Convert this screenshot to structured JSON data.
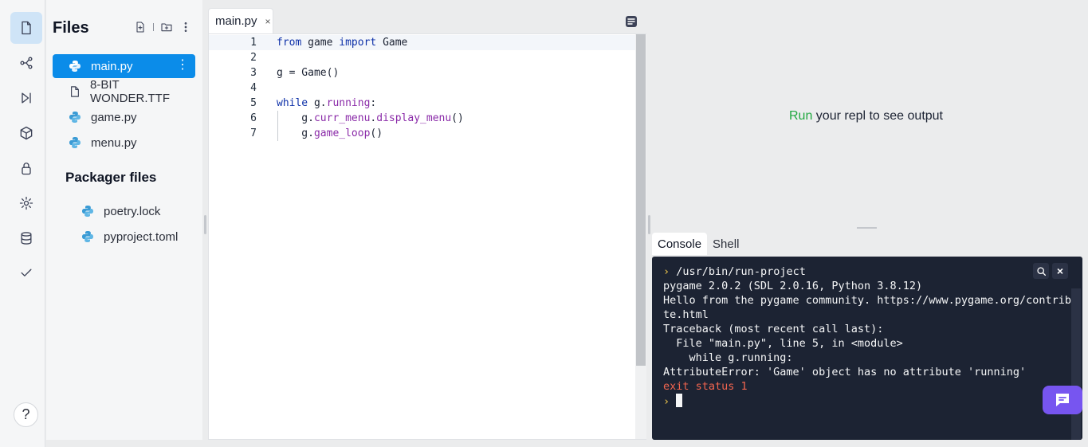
{
  "sidebar": {
    "title": "Files",
    "files": [
      {
        "name": "main.py",
        "icon": "python-icon",
        "active": true
      },
      {
        "name": "8-BIT WONDER.TTF",
        "icon": "file-icon",
        "active": false
      },
      {
        "name": "game.py",
        "icon": "python-icon",
        "active": false
      },
      {
        "name": "menu.py",
        "icon": "python-icon",
        "active": false
      }
    ],
    "packager_title": "Packager files",
    "packager_files": [
      {
        "name": "poetry.lock",
        "icon": "python-icon"
      },
      {
        "name": "pyproject.toml",
        "icon": "python-icon"
      }
    ],
    "more_glyph": "⋮",
    "help_glyph": "?"
  },
  "editor": {
    "tab_label": "main.py",
    "tab_close": "×",
    "lines": [
      {
        "n": "1",
        "text": "from game import Game"
      },
      {
        "n": "2",
        "text": ""
      },
      {
        "n": "3",
        "text": "g = Game()"
      },
      {
        "n": "4",
        "text": ""
      },
      {
        "n": "5",
        "text": "while g.running:"
      },
      {
        "n": "6",
        "text": "    g.curr_menu.display_menu()"
      },
      {
        "n": "7",
        "text": "    g.game_loop()"
      }
    ]
  },
  "output": {
    "run_word": "Run",
    "message": " your repl to see output"
  },
  "console": {
    "tabs": [
      "Console",
      "Shell"
    ],
    "prompt_glyph": "›",
    "lines": [
      "/usr/bin/run-project",
      "pygame 2.0.2 (SDL 2.0.16, Python 3.8.12)",
      "Hello from the pygame community. https://www.pygame.org/contribu",
      "te.html",
      "Traceback (most recent call last):",
      "  File \"main.py\", line 5, in <module>",
      "    while g.running:",
      "AttributeError: 'Game' object has no attribute 'running'",
      "exit status 1"
    ],
    "close_glyph": "×"
  },
  "colors": {
    "accent": "#0b8ce9",
    "console_bg": "#1c2333",
    "run_green": "#20a83f",
    "error_red": "#f2654f",
    "chat_purple": "#7755f0"
  }
}
